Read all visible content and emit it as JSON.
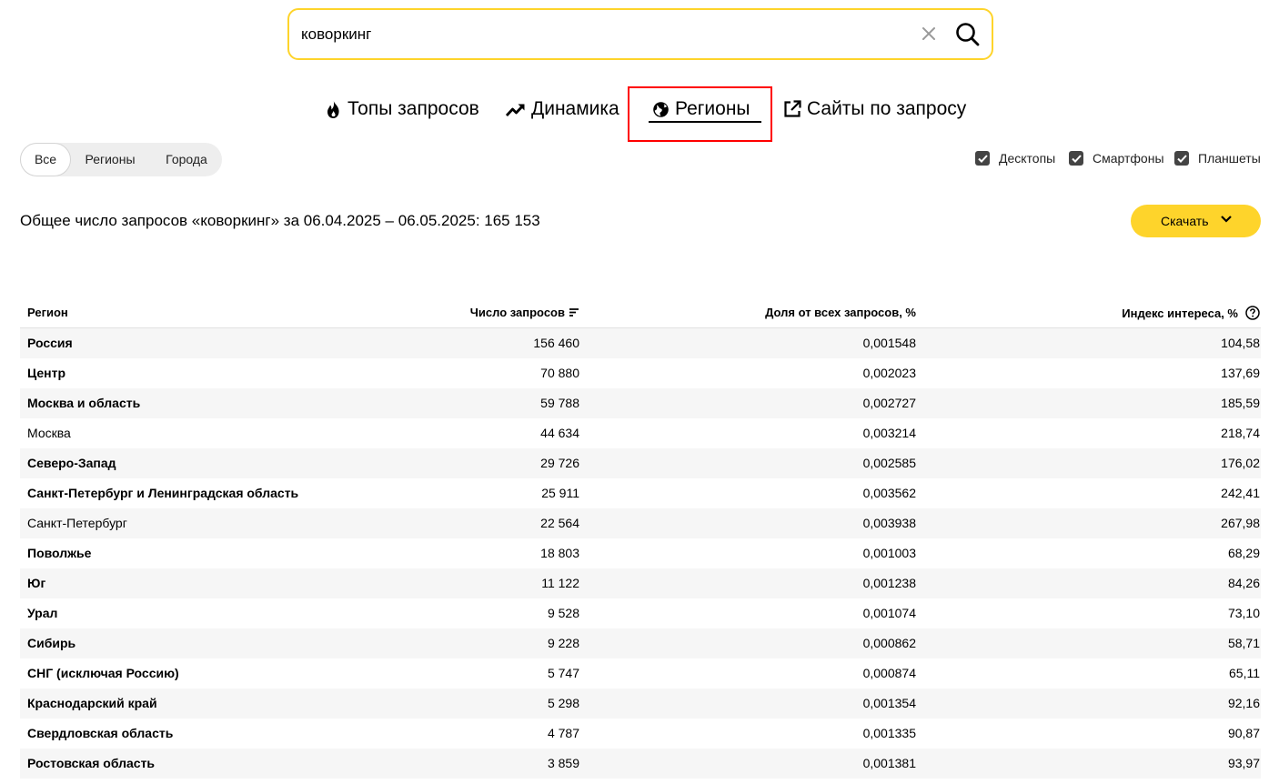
{
  "search": {
    "value": "коворкинг"
  },
  "tabs": [
    {
      "label": "Топы запросов",
      "icon": "fire-icon"
    },
    {
      "label": "Динамика",
      "icon": "trend-up-icon"
    },
    {
      "label": "Регионы",
      "icon": "globe-icon",
      "active": true
    },
    {
      "label": "Сайты по запросу",
      "icon": "external-link-icon"
    }
  ],
  "segmented": {
    "items": [
      "Все",
      "Регионы",
      "Города"
    ],
    "selected": "Все"
  },
  "devices": [
    {
      "label": "Десктопы",
      "checked": true
    },
    {
      "label": "Смартфоны",
      "checked": true
    },
    {
      "label": "Планшеты",
      "checked": true
    }
  ],
  "summary": {
    "text": "Общее число запросов «коворкинг» за 06.04.2025 – 06.05.2025: 165 153"
  },
  "download": {
    "label": "Скачать"
  },
  "table": {
    "headers": {
      "region": "Регион",
      "count": "Число запросов",
      "share": "Доля от всех запросов, %",
      "index": "Индекс интереса, %"
    },
    "rows": [
      {
        "region": "Россия",
        "count": "156 460",
        "share": "0,001548",
        "index": "104,58",
        "bold": true
      },
      {
        "region": "Центр",
        "count": "70 880",
        "share": "0,002023",
        "index": "137,69",
        "bold": true
      },
      {
        "region": "Москва и область",
        "count": "59 788",
        "share": "0,002727",
        "index": "185,59",
        "bold": true
      },
      {
        "region": "Москва",
        "count": "44 634",
        "share": "0,003214",
        "index": "218,74",
        "bold": false
      },
      {
        "region": "Северо-Запад",
        "count": "29 726",
        "share": "0,002585",
        "index": "176,02",
        "bold": true
      },
      {
        "region": "Санкт-Петербург и Ленинградская область",
        "count": "25 911",
        "share": "0,003562",
        "index": "242,41",
        "bold": true
      },
      {
        "region": "Санкт-Петербург",
        "count": "22 564",
        "share": "0,003938",
        "index": "267,98",
        "bold": false
      },
      {
        "region": "Поволжье",
        "count": "18 803",
        "share": "0,001003",
        "index": "68,29",
        "bold": true
      },
      {
        "region": "Юг",
        "count": "11 122",
        "share": "0,001238",
        "index": "84,26",
        "bold": true
      },
      {
        "region": "Урал",
        "count": "9 528",
        "share": "0,001074",
        "index": "73,10",
        "bold": true
      },
      {
        "region": "Сибирь",
        "count": "9 228",
        "share": "0,000862",
        "index": "58,71",
        "bold": true
      },
      {
        "region": "СНГ (исключая Россию)",
        "count": "5 747",
        "share": "0,000874",
        "index": "65,11",
        "bold": true
      },
      {
        "region": "Краснодарский край",
        "count": "5 298",
        "share": "0,001354",
        "index": "92,16",
        "bold": true
      },
      {
        "region": "Свердловская область",
        "count": "4 787",
        "share": "0,001335",
        "index": "90,87",
        "bold": true
      },
      {
        "region": "Ростовская область",
        "count": "3 859",
        "share": "0,001381",
        "index": "93,97",
        "bold": true
      }
    ]
  },
  "colors": {
    "accent": "#fed42b",
    "highlight_frame": "#ff0000",
    "row_stripe": "#f6f6f6"
  }
}
